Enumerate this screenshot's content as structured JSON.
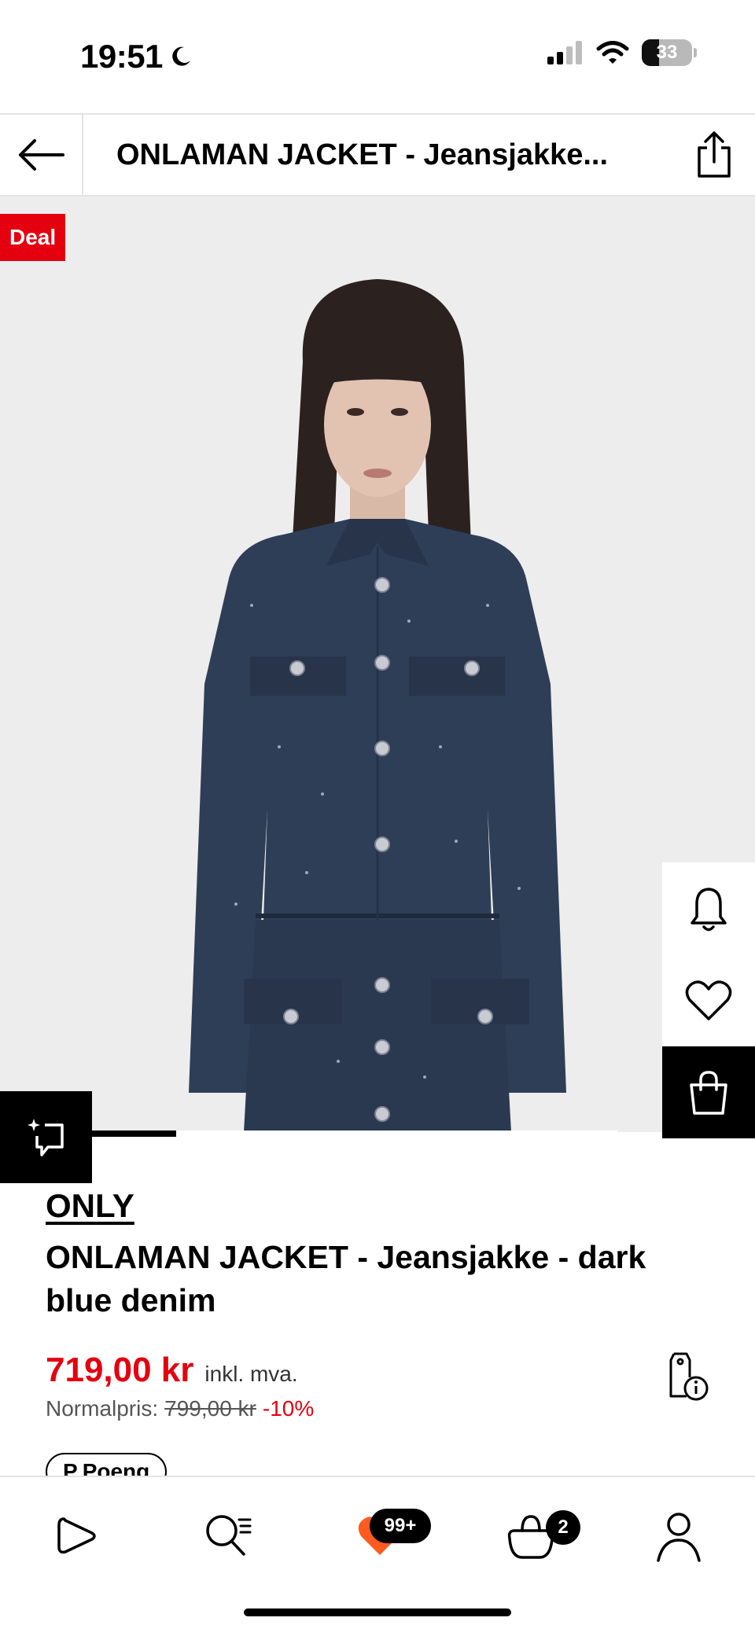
{
  "status_bar": {
    "time": "19:51",
    "battery": "33",
    "icons": [
      "moon-icon",
      "signal-icon",
      "wifi-icon",
      "battery-icon"
    ]
  },
  "header": {
    "title": "ONLAMAN JACKET - Jeansjakke...",
    "icons": [
      "back-arrow-icon",
      "share-icon"
    ]
  },
  "image": {
    "deal_label": "Deal",
    "gallery_progress": 0.16
  },
  "side_actions": [
    "bell-icon",
    "heart-icon",
    "shopping-bag-icon"
  ],
  "product": {
    "brand": "ONLY",
    "name": "ONLAMAN JACKET - Jeansjakke - dark blue denim",
    "price": "719,00 kr",
    "vat_note": "inkl. mva.",
    "normal_label": "Normalpris:",
    "normal_price": "799,00 kr",
    "discount": "-10%",
    "points_label": "Poeng",
    "points_symbol": "P"
  },
  "tabs": [
    {
      "name": "home",
      "icon": "play-icon"
    },
    {
      "name": "search",
      "icon": "search-icon"
    },
    {
      "name": "favourites",
      "icon": "heart-icon",
      "badge": "99+"
    },
    {
      "name": "cart",
      "icon": "bag-icon",
      "badge": "2"
    },
    {
      "name": "profile",
      "icon": "person-icon"
    }
  ],
  "colors": {
    "accent": "#e4000f",
    "dark": "#000000",
    "image_bg": "#ededee",
    "denim": "#2f3e57"
  }
}
